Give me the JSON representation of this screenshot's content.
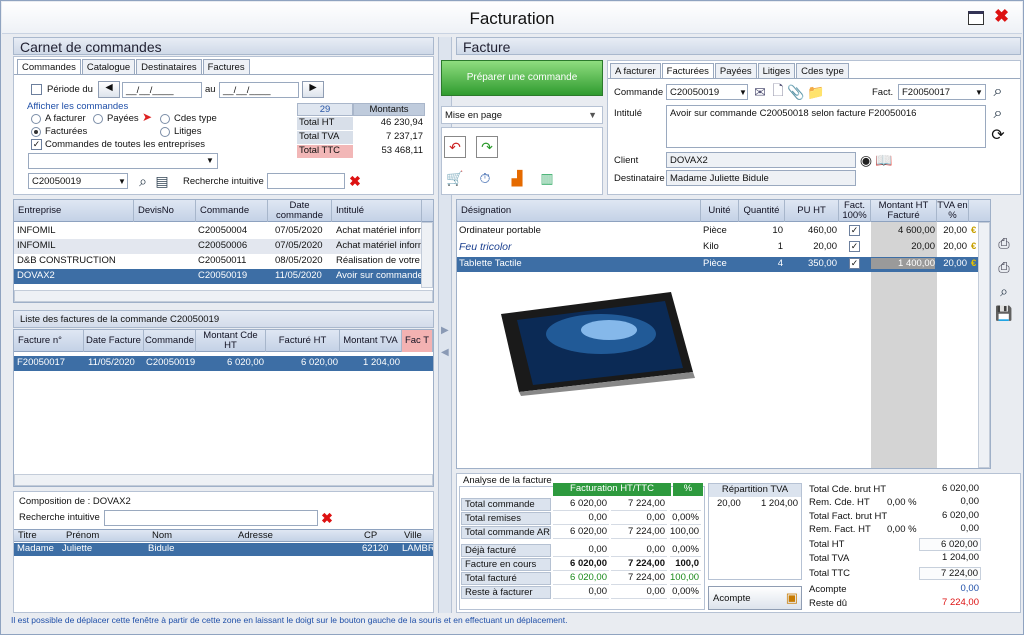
{
  "window": {
    "title": "Facturation"
  },
  "left": {
    "title": "Carnet de commandes",
    "tabs": [
      "Commandes",
      "Catalogue",
      "Destinataires",
      "Factures"
    ],
    "periode_label": "Période du",
    "date_placeholder": "__/__/____",
    "au_label": "au",
    "afficher_label": "Afficher les commandes",
    "radios": [
      "A facturer",
      "Payées",
      "Cdes type",
      "Facturées",
      "Litiges"
    ],
    "toutes_label": "Commandes de toutes les entreprises",
    "stats": {
      "count": "29",
      "montants": "Montants",
      "rows": [
        {
          "label": "Total HT",
          "value": "46 230,94"
        },
        {
          "label": "Total TVA",
          "value": "7 237,17"
        },
        {
          "label": "Total TTC",
          "value": "53 468,11"
        }
      ]
    },
    "commande_value": "C20050019",
    "recherche_label": "Recherche intuitive",
    "orders": {
      "headers": [
        "Entreprise",
        "DevisNo",
        "Commande",
        "Date commande",
        "Intitulé"
      ],
      "rows": [
        [
          "INFOMIL",
          "",
          "C20050004",
          "07/05/2020",
          "Achat matériel informa"
        ],
        [
          "INFOMIL",
          "",
          "C20050006",
          "07/05/2020",
          "Achat matériel informa"
        ],
        [
          "D&B CONSTRUCTION",
          "",
          "C20050011",
          "08/05/2020",
          "Réalisation de votre p"
        ],
        [
          "DOVAX2",
          "",
          "C20050019",
          "11/05/2020",
          "Avoir sur commande"
        ]
      ]
    },
    "invoices": {
      "title": "Liste des factures de la commande C20050019",
      "headers": [
        "Facture n°",
        "Date Facture",
        "Commande",
        "Montant Cde HT",
        "Facturé HT",
        "Montant TVA",
        "Fac T"
      ],
      "rows": [
        [
          "F20050017",
          "11/05/2020",
          "C20050019",
          "6 020,00",
          "6 020,00",
          "1 204,00"
        ]
      ]
    },
    "composition": {
      "title": "Composition de : DOVAX2",
      "recherche_label": "Recherche intuitive",
      "headers": [
        "Titre",
        "Prénom",
        "Nom",
        "Adresse",
        "CP",
        "Ville"
      ],
      "rows": [
        [
          "Madame",
          "Juliette",
          "Bidule",
          "",
          "62120",
          "LAMBRI"
        ]
      ]
    }
  },
  "right": {
    "title": "Facture",
    "prepare_button": "Préparer une commande",
    "mise_en_page": "Mise en page",
    "tabs": [
      "A facturer",
      "Facturées",
      "Payées",
      "Litiges",
      "Cdes type"
    ],
    "commande_label": "Commande",
    "commande_value": "C20050019",
    "fact_label": "Fact.",
    "fact_value": "F20050017",
    "intitule_label": "Intitulé",
    "intitule_value": "Avoir sur commande C20050018 selon facture F20050016",
    "client_label": "Client",
    "client_value": "DOVAX2",
    "destinataire_label": "Destinataire",
    "destinataire_value": "Madame Juliette Bidule",
    "lines": {
      "headers": [
        "Désignation",
        "Unité",
        "Quantité",
        "PU HT",
        "Fact. 100%",
        "Montant HT Facturé",
        "TVA en %"
      ],
      "rows": [
        [
          "Ordinateur portable",
          "Pièce",
          "10",
          "460,00",
          "✓",
          "4 600,00",
          "20,00"
        ],
        [
          "Feu tricolor",
          "Kilo",
          "1",
          "20,00",
          "✓",
          "20,00",
          "20,00"
        ],
        [
          "Tablette Tactile",
          "Pièce",
          "4",
          "350,00",
          "✓",
          "1 400,00",
          "20,00"
        ]
      ]
    },
    "analyse": {
      "title": "Analyse de la facture",
      "col_header": "Facturation HT/TTC",
      "pct": "%",
      "rows": [
        [
          "Total commande",
          "6 020,00",
          "7 224,00",
          ""
        ],
        [
          "Total remises",
          "0,00",
          "0,00",
          "0,00%"
        ],
        [
          "Total commande AR",
          "6 020,00",
          "7 224,00",
          "100,00"
        ],
        [
          "Déjà facturé",
          "0,00",
          "0,00",
          "0,00%"
        ],
        [
          "Facture en cours",
          "6 020,00",
          "7 224,00",
          "100,0"
        ],
        [
          "Total facturé",
          "6 020,00",
          "7 224,00",
          "100,00"
        ],
        [
          "Reste à facturer",
          "0,00",
          "0,00",
          "0,00%"
        ]
      ],
      "tva_header": "Répartition TVA",
      "tva_rate": "20,00",
      "tva_amount": "1 204,00",
      "acompte_button": "Acompte"
    },
    "totals": [
      {
        "label": "Total Cde. brut HT",
        "pct": "",
        "value": "6 020,00"
      },
      {
        "label": "Rem. Cde. HT",
        "pct": "0,00 %",
        "value": "0,00"
      },
      {
        "label": "Total Fact. brut HT",
        "pct": "",
        "value": "6 020,00"
      },
      {
        "label": "Rem. Fact. HT",
        "pct": "0,00 %",
        "value": "0,00"
      },
      {
        "label": "Total HT",
        "pct": "",
        "value": "6 020,00"
      },
      {
        "label": "Total TVA",
        "pct": "",
        "value": "1 204,00"
      },
      {
        "label": "Total TTC",
        "pct": "",
        "value": "7 224,00"
      },
      {
        "label": "Acompte",
        "pct": "",
        "value": "0,00"
      },
      {
        "label": "Reste dû",
        "pct": "",
        "value": "7 224,00"
      }
    ]
  },
  "status": "Il est possible de déplacer cette fenêtre à partir de cette zone en laissant le doigt sur le bouton gauche de la souris et en effectuant un déplacement."
}
